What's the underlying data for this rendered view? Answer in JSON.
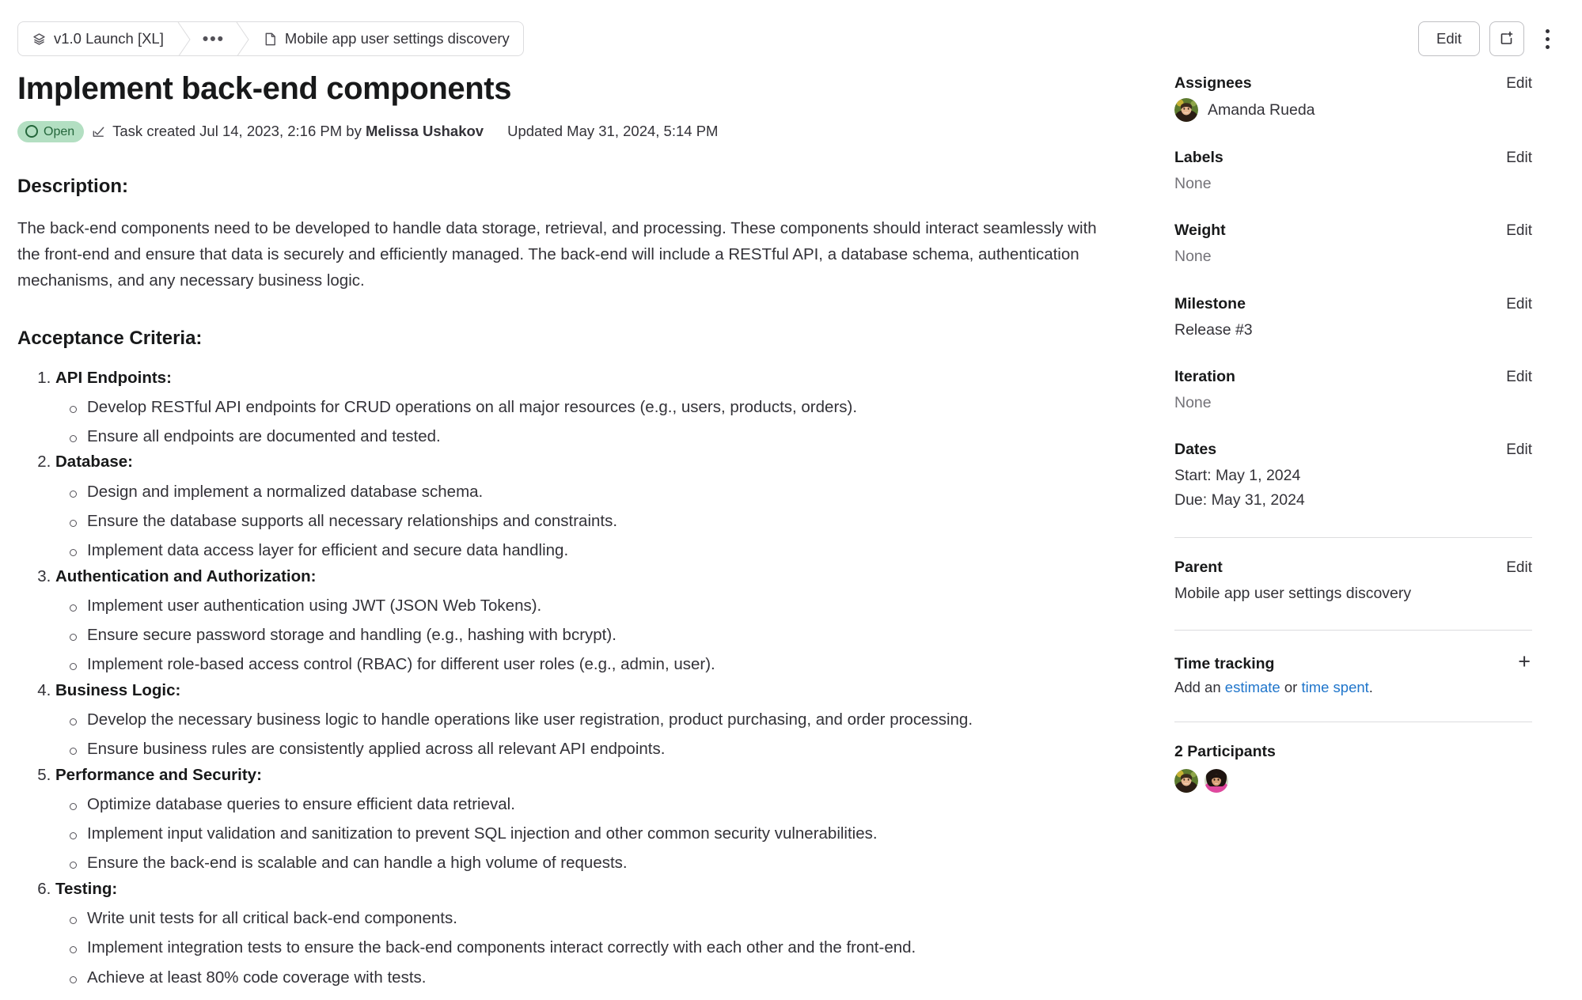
{
  "breadcrumb": {
    "items": [
      {
        "label": "v1.0 Launch [XL]",
        "icon": "project-layers-icon"
      },
      {
        "label": "•••",
        "icon": "ellipsis-icon"
      },
      {
        "label": "Mobile app user settings discovery",
        "icon": "epic-page-icon"
      }
    ]
  },
  "toolbar": {
    "edit_label": "Edit",
    "new_item_icon": "new-item-icon",
    "more_actions_icon": "kebab-menu-icon"
  },
  "header": {
    "title": "Implement back-end components",
    "status": "Open",
    "status_icon": "open-circle-icon",
    "task_icon": "task-check-icon",
    "created_prefix": "Task created ",
    "created_date": "Jul 14, 2023, 2:16 PM",
    "created_by_prefix": " by ",
    "created_by": "Melissa Ushakov",
    "updated": "Updated May 31, 2024, 5:14 PM"
  },
  "description": {
    "heading": "Description:",
    "body": "The back-end components need to be developed to handle data storage, retrieval, and processing. These components should interact seamlessly with the front-end and ensure that data is securely and efficiently managed. The back-end will include a RESTful API, a database schema, authentication mechanisms, and any necessary business logic."
  },
  "acceptance_criteria": {
    "heading": "Acceptance Criteria:",
    "items": [
      {
        "title": "API Endpoints:",
        "subitems": [
          "Develop RESTful API endpoints for CRUD operations on all major resources (e.g., users, products, orders).",
          "Ensure all endpoints are documented and tested."
        ]
      },
      {
        "title": "Database:",
        "subitems": [
          "Design and implement a normalized database schema.",
          "Ensure the database supports all necessary relationships and constraints.",
          "Implement data access layer for efficient and secure data handling."
        ]
      },
      {
        "title": "Authentication and Authorization:",
        "subitems": [
          "Implement user authentication using JWT (JSON Web Tokens).",
          "Ensure secure password storage and handling (e.g., hashing with bcrypt).",
          "Implement role-based access control (RBAC) for different user roles (e.g., admin, user)."
        ]
      },
      {
        "title": "Business Logic:",
        "subitems": [
          "Develop the necessary business logic to handle operations like user registration, product purchasing, and order processing.",
          "Ensure business rules are consistently applied across all relevant API endpoints."
        ]
      },
      {
        "title": "Performance and Security:",
        "subitems": [
          "Optimize database queries to ensure efficient data retrieval.",
          "Implement input validation and sanitization to prevent SQL injection and other common security vulnerabilities.",
          "Ensure the back-end is scalable and can handle a high volume of requests."
        ]
      },
      {
        "title": "Testing:",
        "subitems": [
          "Write unit tests for all critical back-end components.",
          "Implement integration tests to ensure the back-end components interact correctly with each other and the front-end.",
          "Achieve at least 80% code coverage with tests."
        ]
      }
    ]
  },
  "sidebar": {
    "assignees": {
      "label": "Assignees",
      "edit_label": "Edit",
      "name": "Amanda Rueda"
    },
    "labels": {
      "label": "Labels",
      "edit_label": "Edit",
      "value": "None"
    },
    "weight": {
      "label": "Weight",
      "edit_label": "Edit",
      "value": "None"
    },
    "milestone": {
      "label": "Milestone",
      "edit_label": "Edit",
      "value": "Release #3"
    },
    "iteration": {
      "label": "Iteration",
      "edit_label": "Edit",
      "value": "None"
    },
    "dates": {
      "label": "Dates",
      "edit_label": "Edit",
      "start": "Start: May 1, 2024",
      "due": "Due: May 31, 2024"
    },
    "parent": {
      "label": "Parent",
      "edit_label": "Edit",
      "value": "Mobile app user settings discovery"
    },
    "time_tracking": {
      "label": "Time tracking",
      "add_icon": "plus-icon",
      "prefix": "Add an ",
      "estimate_link": "estimate",
      "middle": " or ",
      "time_spent_link": "time spent",
      "suffix": "."
    },
    "participants": {
      "title": "2 Participants"
    }
  },
  "colors": {
    "status_bg": "#b3dfc2",
    "status_fg": "#24663b",
    "link": "#1f75cb",
    "text": "#333238",
    "muted": "#737278",
    "border": "#dcdcde"
  }
}
